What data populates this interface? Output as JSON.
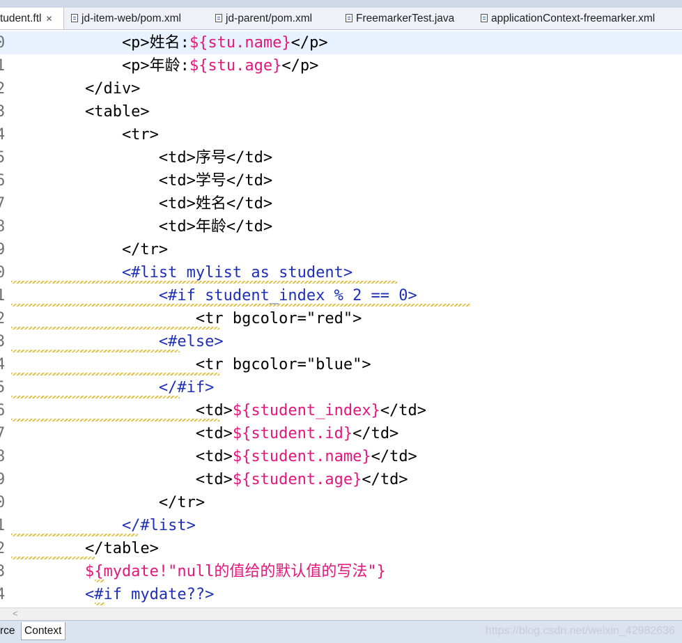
{
  "tabs": [
    {
      "label": "tudent.ftl",
      "active": true,
      "icon": "none",
      "closable": true
    },
    {
      "label": "jd-item-web/pom.xml",
      "icon": "maven-file-icon"
    },
    {
      "label": "jd-parent/pom.xml",
      "icon": "maven-file-icon"
    },
    {
      "label": "FreemarkerTest.java",
      "icon": "java-file-icon"
    },
    {
      "label": "applicationContext-freemarker.xml",
      "icon": "xml-file-icon"
    }
  ],
  "tab_close_glyph": "✕",
  "editor": {
    "lines": [
      {
        "num": "0",
        "tokens": [
          {
            "t": "            <p>姓名:",
            "c": "tag"
          },
          {
            "t": "${stu.name}",
            "c": "expr"
          },
          {
            "t": "</p>",
            "c": "tag"
          }
        ]
      },
      {
        "num": "1",
        "tokens": [
          {
            "t": "            <p>年龄:",
            "c": "tag"
          },
          {
            "t": "${stu.age}",
            "c": "expr"
          },
          {
            "t": "</p>",
            "c": "tag"
          }
        ]
      },
      {
        "num": "2",
        "tokens": [
          {
            "t": "        </div>",
            "c": "tag"
          }
        ]
      },
      {
        "num": "3",
        "tokens": [
          {
            "t": "        <table>",
            "c": "tag"
          }
        ]
      },
      {
        "num": "4",
        "tokens": [
          {
            "t": "            <tr>",
            "c": "tag"
          }
        ]
      },
      {
        "num": "5",
        "tokens": [
          {
            "t": "                <td>序号</td>",
            "c": "tag"
          }
        ]
      },
      {
        "num": "6",
        "tokens": [
          {
            "t": "                <td>学号</td>",
            "c": "tag"
          }
        ]
      },
      {
        "num": "7",
        "tokens": [
          {
            "t": "                <td>姓名</td>",
            "c": "tag"
          }
        ]
      },
      {
        "num": "8",
        "tokens": [
          {
            "t": "                <td>年龄</td>",
            "c": "tag"
          }
        ]
      },
      {
        "num": "9",
        "tokens": [
          {
            "t": "            </tr>",
            "c": "tag"
          }
        ]
      },
      {
        "num": "0",
        "tokens": [
          {
            "t": "            <#list mylist as student>",
            "c": "dir"
          }
        ]
      },
      {
        "num": "1",
        "tokens": [
          {
            "t": "                <#if student_index % 2 == 0>",
            "c": "dir"
          }
        ]
      },
      {
        "num": "2",
        "tokens": [
          {
            "t": "                    <tr bgcolor=\"red\">",
            "c": "tag"
          }
        ]
      },
      {
        "num": "3",
        "tokens": [
          {
            "t": "                <#else>",
            "c": "dir"
          }
        ]
      },
      {
        "num": "4",
        "tokens": [
          {
            "t": "                    <tr bgcolor=\"blue\">",
            "c": "tag"
          }
        ]
      },
      {
        "num": "5",
        "tokens": [
          {
            "t": "                </#if>",
            "c": "dir"
          }
        ]
      },
      {
        "num": "6",
        "tokens": [
          {
            "t": "                    <td>",
            "c": "tag"
          },
          {
            "t": "${student_index}",
            "c": "expr"
          },
          {
            "t": "</td>",
            "c": "tag"
          }
        ]
      },
      {
        "num": "7",
        "tokens": [
          {
            "t": "                    <td>",
            "c": "tag"
          },
          {
            "t": "${student.id}",
            "c": "expr"
          },
          {
            "t": "</td>",
            "c": "tag"
          }
        ]
      },
      {
        "num": "8",
        "tokens": [
          {
            "t": "                    <td>",
            "c": "tag"
          },
          {
            "t": "${student.name}",
            "c": "expr"
          },
          {
            "t": "</td>",
            "c": "tag"
          }
        ]
      },
      {
        "num": "9",
        "tokens": [
          {
            "t": "                    <td>",
            "c": "tag"
          },
          {
            "t": "${student.age}",
            "c": "expr"
          },
          {
            "t": "</td>",
            "c": "tag"
          }
        ]
      },
      {
        "num": "0",
        "tokens": [
          {
            "t": "                </tr>",
            "c": "tag"
          }
        ]
      },
      {
        "num": "1",
        "tokens": [
          {
            "t": "            </#list>",
            "c": "dir"
          }
        ]
      },
      {
        "num": "2",
        "tokens": [
          {
            "t": "        </table>",
            "c": "tag"
          }
        ]
      },
      {
        "num": "3",
        "tokens": [
          {
            "t": "        ${mydate!\"null的值给的默认值的写法\"}",
            "c": "expr"
          }
        ]
      },
      {
        "num": "4",
        "tokens": [
          {
            "t": "        <#if mydate??>",
            "c": "dir"
          }
        ]
      }
    ]
  },
  "scroll_left_glyph": "<",
  "bottom_tabs": [
    {
      "label": "rce",
      "active": false
    },
    {
      "label": "Context",
      "active": true
    }
  ],
  "watermark": "https://blog.csdn.net/weixin_42982636",
  "colors": {
    "tag": "#000000",
    "expression": "#e4167c",
    "directive": "#1d2fb6",
    "current_line": "#e8f2fe"
  }
}
